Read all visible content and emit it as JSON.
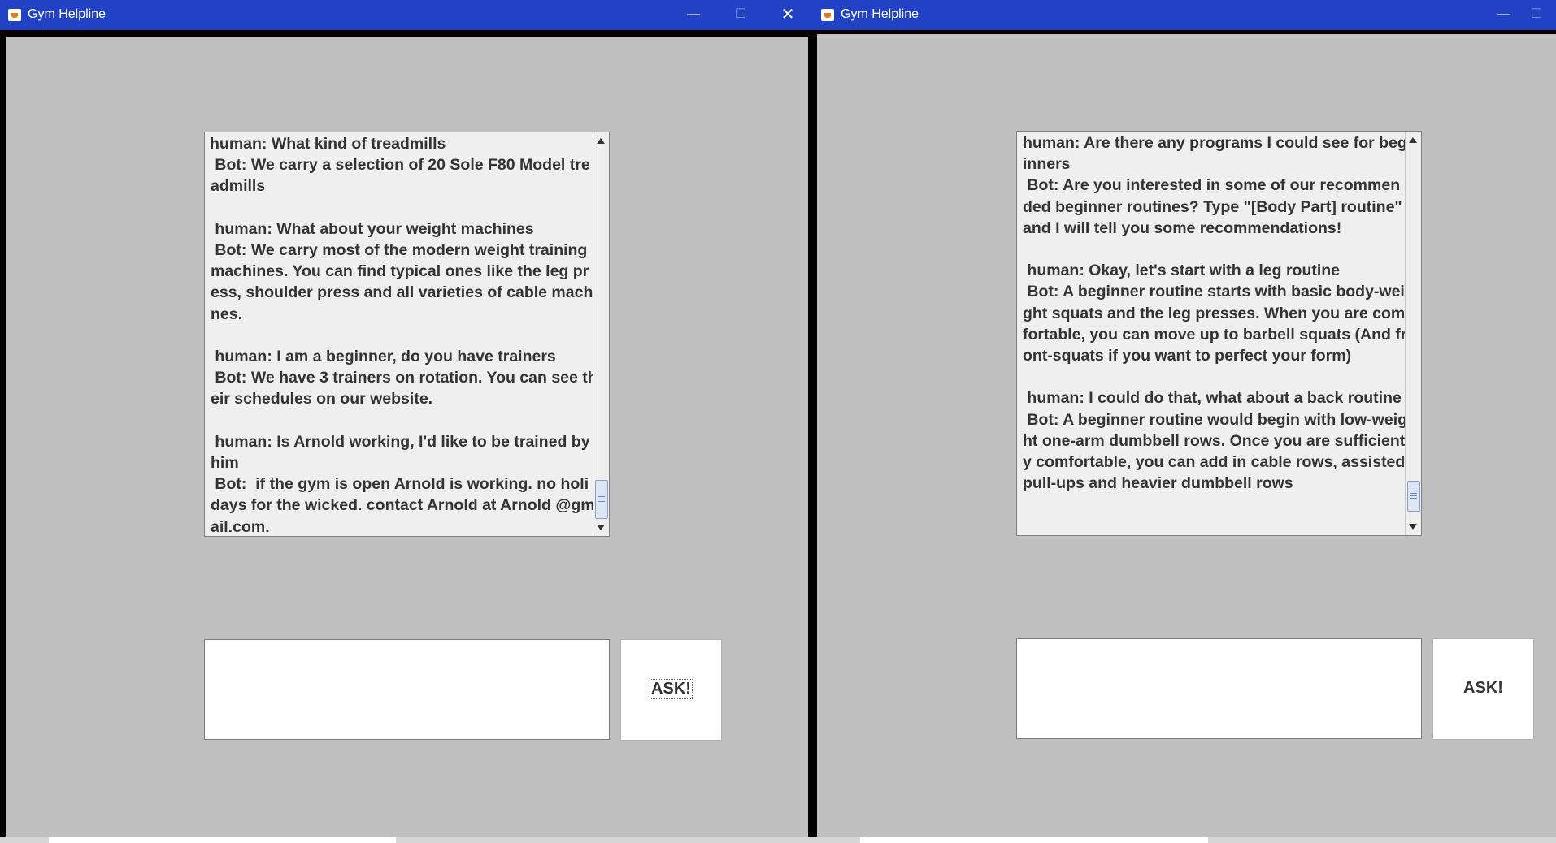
{
  "windows": [
    {
      "title": "Gym Helpline",
      "controls": {
        "minimize": "—",
        "maximize": "☐",
        "close": "✕"
      },
      "transcript": "human: What kind of treadmills\n Bot: We carry a selection of 20 Sole F80 Model treadmills\n\n human: What about your weight machines\n Bot: We carry most of the modern weight training machines. You can find typical ones like the leg press, shoulder press and all varieties of cable machines.\n\n human: I am a beginner, do you have trainers\n Bot: We have 3 trainers on rotation. You can see their schedules on our website.\n\n human: Is Arnold working, I'd like to be trained by him\n Bot:  if the gym is open Arnold is working. no holidays for the wicked. contact Arnold at Arnold @gmail.com.",
      "input_value": "",
      "ask_label": "ASK!"
    },
    {
      "title": "Gym Helpline",
      "controls": {
        "minimize": "—",
        "maximize": "☐"
      },
      "transcript": "human: Are there any programs I could see for beginners\n Bot: Are you interested in some of our recommended beginner routines? Type \"[Body Part] routine\" and I will tell you some recommendations!\n\n human: Okay, let's start with a leg routine\n Bot: A beginner routine starts with basic body-weight squats and the leg presses. When you are comfortable, you can move up to barbell squats (And front-squats if you want to perfect your form)\n\n human: I could do that, what about a back routine\n Bot: A beginner routine would begin with low-weight one-arm dumbbell rows. Once you are sufficiently comfortable, you can add in cable rows, assisted pull-ups and heavier dumbbell rows",
      "input_value": "",
      "ask_label": "ASK!"
    }
  ]
}
